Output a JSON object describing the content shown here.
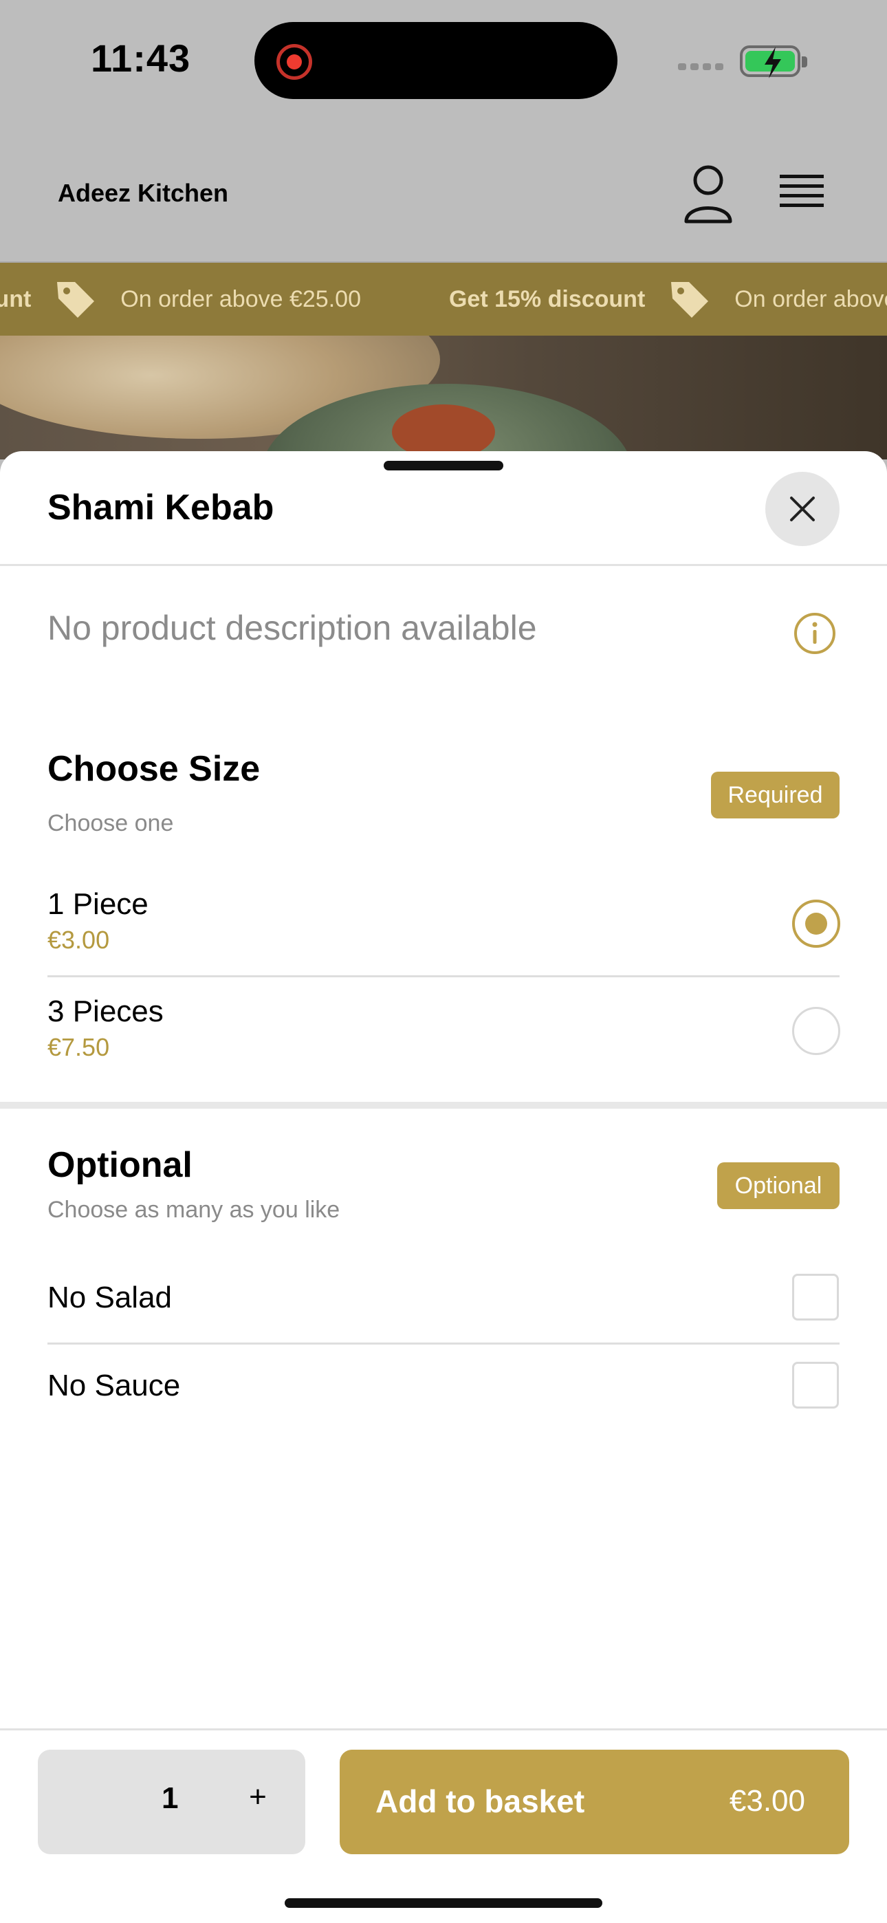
{
  "status_bar": {
    "time": "11:43"
  },
  "header": {
    "brand": "Adeez Kitchen"
  },
  "promo": {
    "items": [
      {
        "title": "Get 15% discount",
        "subtitle": "On order above €25.00"
      },
      {
        "title": "Get 15% discount",
        "subtitle": "On order above €25.00"
      }
    ]
  },
  "sheet": {
    "title": "Shami Kebab",
    "description": "No product description available",
    "size_section": {
      "title": "Choose Size",
      "subtitle": "Choose one",
      "badge": "Required",
      "options": [
        {
          "name": "1 Piece",
          "price": "€3.00",
          "selected": true
        },
        {
          "name": "3 Pieces",
          "price": "€7.50",
          "selected": false
        }
      ]
    },
    "optional_section": {
      "title": "Optional",
      "subtitle": "Choose as many as you like",
      "badge": "Optional",
      "options": [
        {
          "name": "No Salad",
          "checked": false
        },
        {
          "name": "No Sauce",
          "checked": false
        }
      ]
    }
  },
  "footer": {
    "quantity": "1",
    "plus": "+",
    "add_label": "Add to basket",
    "total": "€3.00"
  },
  "colors": {
    "accent": "#c0a24b",
    "promo_bg": "#8e7a3a",
    "price": "#b4993f"
  },
  "icons": [
    "user-icon",
    "menu-icon",
    "tag-icon",
    "close-icon",
    "info-icon"
  ]
}
